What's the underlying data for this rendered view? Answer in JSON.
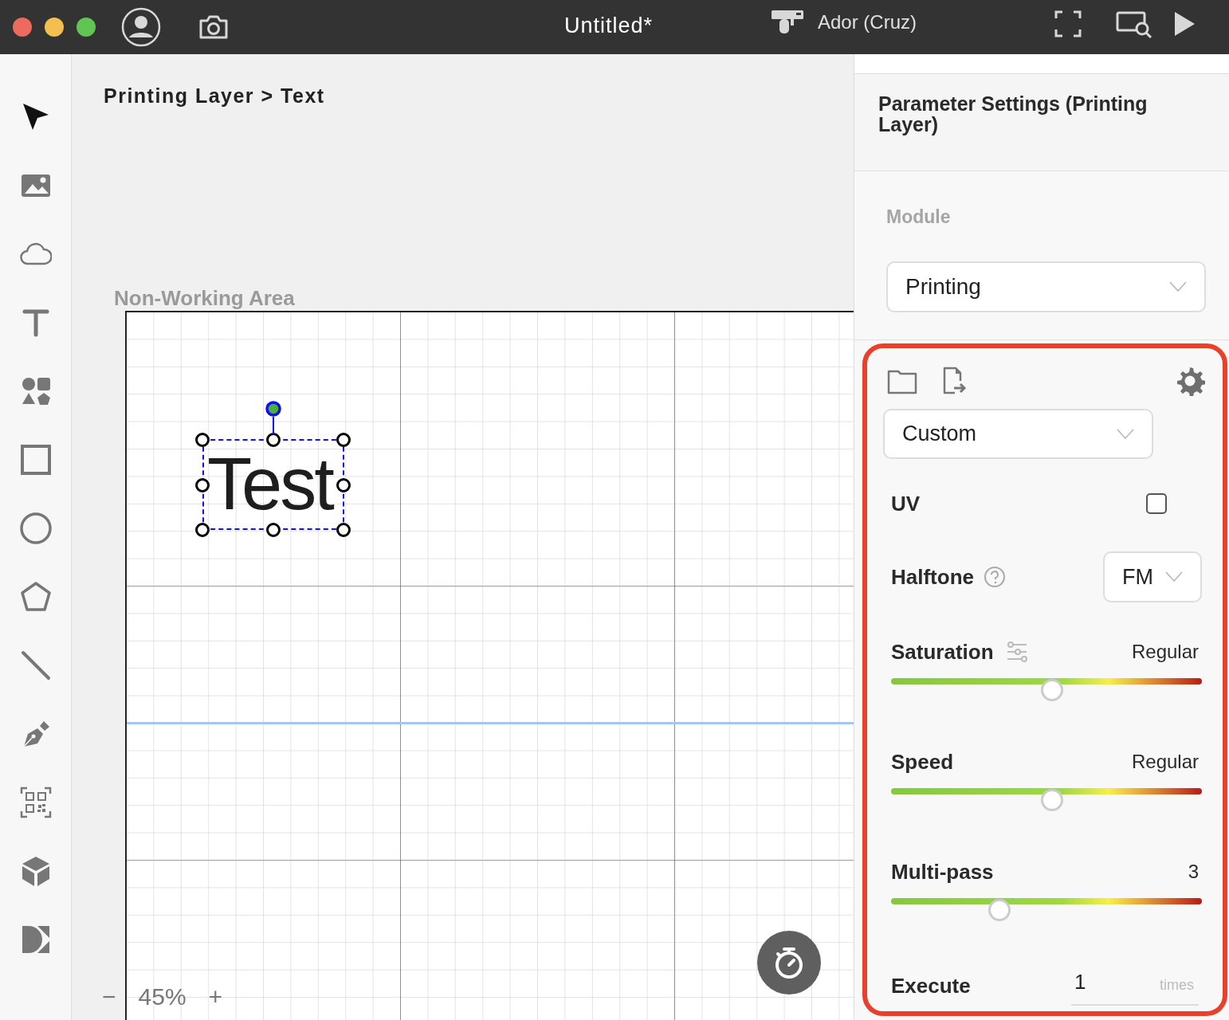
{
  "title_bar": {
    "title": "Untitled*",
    "device": "Ador (Cruz)"
  },
  "toolbar": [
    {
      "kind": "select",
      "selected": true
    },
    {
      "kind": "image",
      "selected": false
    },
    {
      "kind": "cloud",
      "selected": false
    },
    {
      "kind": "text",
      "selected": false
    },
    {
      "kind": "shapes",
      "selected": false
    },
    {
      "kind": "rectangle",
      "selected": false
    },
    {
      "kind": "ellipse",
      "selected": false
    },
    {
      "kind": "polygon",
      "selected": false
    },
    {
      "kind": "line",
      "selected": false
    },
    {
      "kind": "pen",
      "selected": false
    },
    {
      "kind": "qrcode",
      "selected": false
    },
    {
      "kind": "cube",
      "selected": false
    },
    {
      "kind": "dmkit",
      "selected": false
    }
  ],
  "canvas": {
    "breadcrumb": "Printing Layer > Text",
    "area_label": "Non-Working Area",
    "object_text": "Test",
    "zoom_out": "−",
    "zoom": "45%",
    "zoom_in": "+"
  },
  "panel": {
    "title": "Parameter Settings (Printing Layer)",
    "module_label": "Module",
    "module_value": "Printing",
    "preset": "Custom",
    "uv": {
      "label": "UV",
      "checked": false
    },
    "halftone": {
      "label": "Halftone",
      "value": "FM"
    },
    "sliders": [
      {
        "label": "Saturation",
        "reading": "Regular",
        "level": 0.5,
        "has_settings": true
      },
      {
        "label": "Speed",
        "reading": "Regular",
        "level": 0.5,
        "has_settings": false
      },
      {
        "label": "Multi-pass",
        "reading": "3",
        "level": 0.33,
        "has_settings": false
      }
    ],
    "execute": {
      "label": "Execute",
      "value": "1",
      "unit": "times"
    }
  }
}
